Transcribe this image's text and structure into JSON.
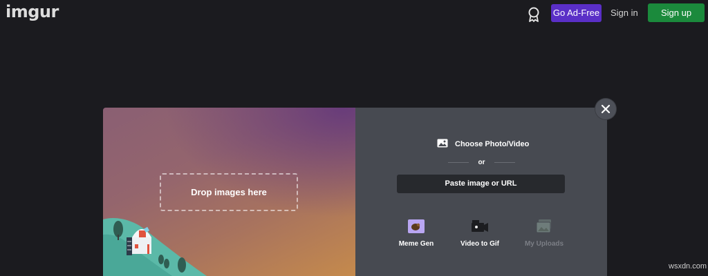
{
  "header": {
    "logo": "imgur",
    "award_icon": "ribbon-award-icon",
    "go_ad_free_label": "Go Ad-Free",
    "sign_in_label": "Sign in",
    "sign_up_label": "Sign up",
    "colors": {
      "ad_free": "#5a2fc7",
      "sign_up": "#1b8a3c"
    }
  },
  "upload_modal": {
    "drop_label": "Drop images here",
    "choose_label": "Choose Photo/Video",
    "choose_icon": "image-icon",
    "or_label": "or",
    "paste_label": "Paste image or URL",
    "close_icon": "close-icon",
    "tools": [
      {
        "label": "Meme Gen",
        "icon": "meme-gen-icon",
        "enabled": true
      },
      {
        "label": "Video to Gif",
        "icon": "video-camera-icon",
        "enabled": true
      },
      {
        "label": "My Uploads",
        "icon": "uploads-stack-icon",
        "enabled": false
      }
    ]
  },
  "watermark": "wsxdn.com"
}
